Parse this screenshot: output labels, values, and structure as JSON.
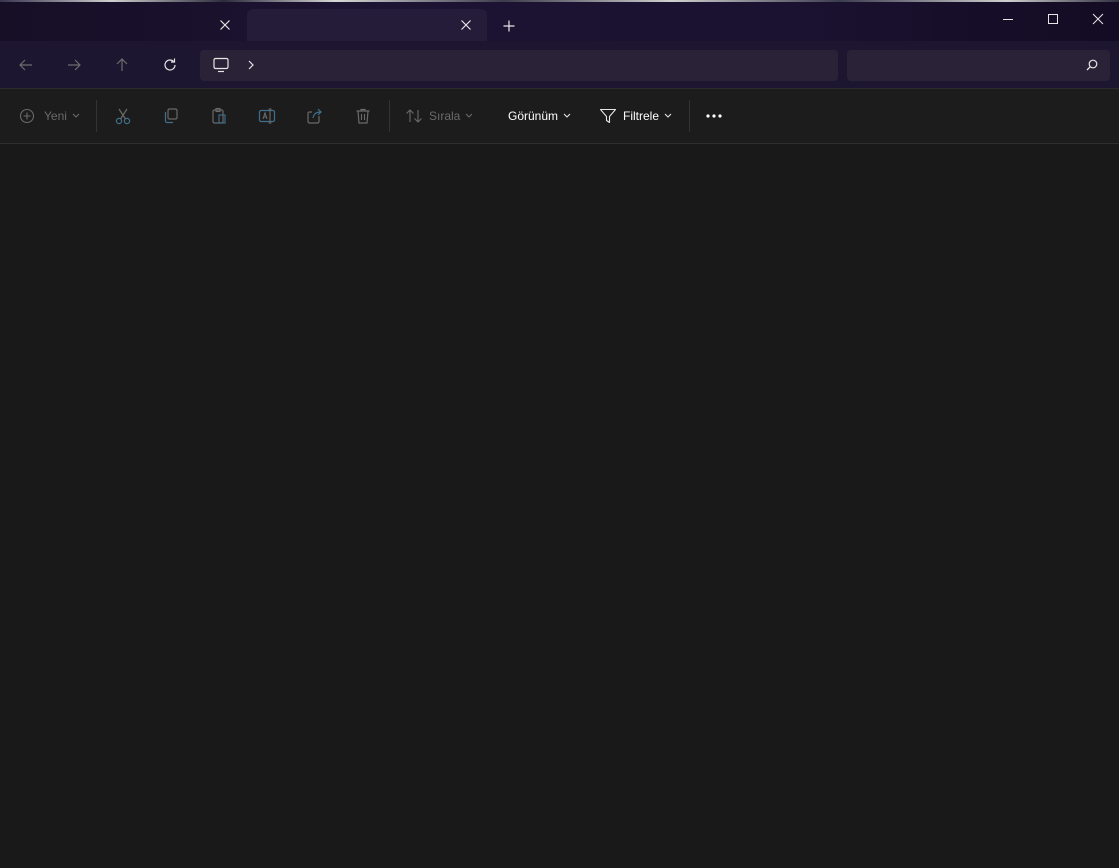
{
  "window": {
    "tabs": [
      {
        "title": "",
        "active": false
      },
      {
        "title": "",
        "active": true
      }
    ],
    "new_tab_icon": "plus-icon",
    "controls": [
      "minimize-icon",
      "maximize-icon",
      "close-icon"
    ]
  },
  "navigation": {
    "back_icon": "arrow-left-icon",
    "forward_icon": "arrow-right-icon",
    "up_icon": "arrow-up-icon",
    "refresh_icon": "refresh-icon",
    "address": {
      "location_icon": "this-pc-icon",
      "separator_icon": "chevron-right-icon",
      "path": ""
    },
    "search": {
      "placeholder": "",
      "icon": "search-icon"
    }
  },
  "commandbar": {
    "new_label": "Yeni",
    "sort_label": "Sırala",
    "view_label": "Görünüm",
    "filter_label": "Filtrele",
    "icons": [
      "cut-icon",
      "copy-icon",
      "paste-icon",
      "rename-icon",
      "share-icon",
      "delete-icon"
    ],
    "more_icon": "more-icon"
  },
  "colors": {
    "titlebar": "#1a1230",
    "navbar": "#1d1630",
    "commandbar": "#1c1c1c",
    "content": "#191919",
    "text_enabled": "#ffffff",
    "text_disabled": "#6a6a6a"
  }
}
